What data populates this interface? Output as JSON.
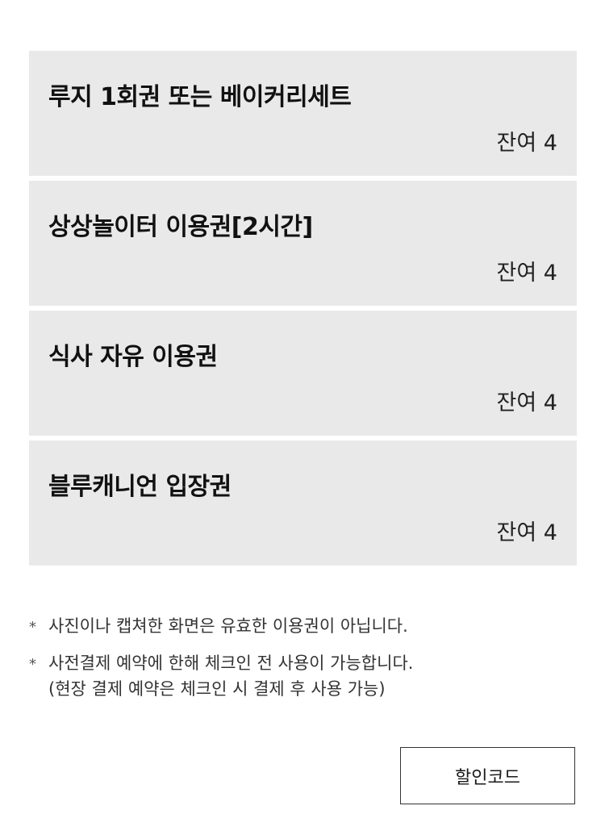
{
  "tickets": [
    {
      "title": "루지 1회권 또는 베이커리세트",
      "remaining": "잔여 4"
    },
    {
      "title": "상상놀이터 이용권[2시간]",
      "remaining": "잔여 4"
    },
    {
      "title": "식사 자유 이용권",
      "remaining": "잔여 4"
    },
    {
      "title": "블루캐니언 입장권",
      "remaining": "잔여 4"
    }
  ],
  "notes": {
    "bullet": "*",
    "note1": "사진이나 캡쳐한 화면은 유효한 이용권이 아닙니다.",
    "note2": "사전결제 예약에 한해 체크인 전 사용이 가능합니다.",
    "note2_sub": "(현장 결제 예약은 체크인 시 결제 후 사용 가능)"
  },
  "discount_button": {
    "label": "할인코드"
  }
}
